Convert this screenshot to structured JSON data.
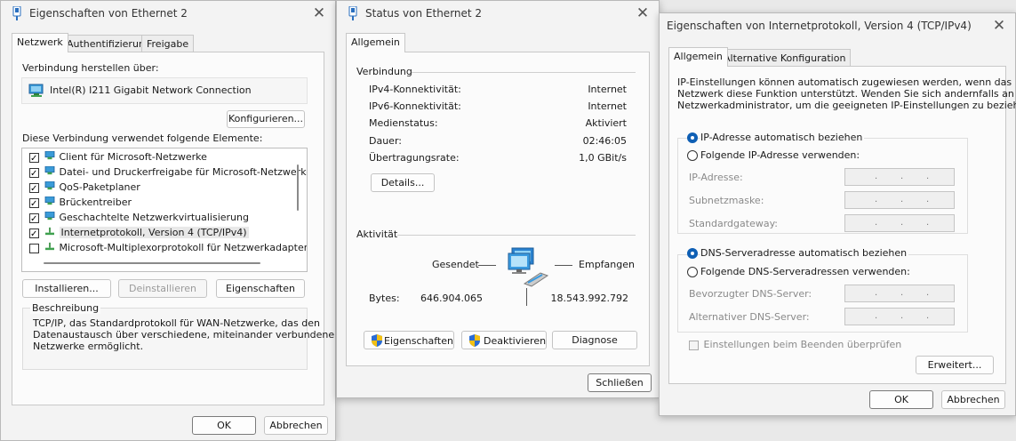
{
  "ethernet_props": {
    "title": "Eigenschaften von Ethernet 2",
    "tabs": [
      "Netzwerk",
      "Authentifizierung",
      "Freigabe"
    ],
    "connect_via_label": "Verbindung herstellen über:",
    "adapter_name": "Intel(R) I211 Gigabit Network Connection",
    "configure_button": "Konfigurieren...",
    "items_label": "Diese Verbindung verwendet folgende Elemente:",
    "items": [
      {
        "label": "Client für Microsoft-Netzwerke",
        "checked": true
      },
      {
        "label": "Datei- und Druckerfreigabe für Microsoft-Netzwerke",
        "checked": true
      },
      {
        "label": "QoS-Paketplaner",
        "checked": true
      },
      {
        "label": "Brückentreiber",
        "checked": true
      },
      {
        "label": "Geschachtelte Netzwerkvirtualisierung",
        "checked": true
      },
      {
        "label": "Internetprotokoll, Version 4 (TCP/IPv4)",
        "checked": true
      },
      {
        "label": "Microsoft-Multiplexorprotokoll für Netzwerkadapter",
        "checked": false
      }
    ],
    "install_button": "Installieren...",
    "uninstall_button": "Deinstallieren",
    "properties_button": "Eigenschaften",
    "description_label": "Beschreibung",
    "description_text_1": "TCP/IP, das Standardprotokoll für WAN-Netzwerke, das den",
    "description_text_2": "Datenaustausch über verschiedene, miteinander verbundene",
    "description_text_3": "Netzwerke ermöglicht.",
    "ok_button": "OK",
    "cancel_button": "Abbrechen"
  },
  "status": {
    "title": "Status von Ethernet 2",
    "tab": "Allgemein",
    "connection_label": "Verbindung",
    "rows": [
      {
        "label": "IPv4-Konnektivität:",
        "value": "Internet"
      },
      {
        "label": "IPv6-Konnektivität:",
        "value": "Internet"
      },
      {
        "label": "Medienstatus:",
        "value": "Aktiviert"
      },
      {
        "label": "Dauer:",
        "value": "02:46:05"
      },
      {
        "label": "Übertragungsrate:",
        "value": "1,0 GBit/s"
      }
    ],
    "details_button": "Details...",
    "activity_label": "Aktivität",
    "sent_label": "Gesendet",
    "received_label": "Empfangen",
    "bytes_label": "Bytes:",
    "bytes_sent": "646.904.065",
    "bytes_received": "18.543.992.792",
    "properties_button": "Eigenschaften",
    "disable_button": "Deaktivieren",
    "diagnose_button": "Diagnose",
    "close_button": "Schließen"
  },
  "ipv4": {
    "title": "Eigenschaften von Internetprotokoll, Version 4 (TCP/IPv4)",
    "tabs": [
      "Allgemein",
      "Alternative Konfiguration"
    ],
    "intro_1": "IP-Einstellungen können automatisch zugewiesen werden, wenn das",
    "intro_2": "Netzwerk diese Funktion unterstützt. Wenden Sie sich andernfalls an den",
    "intro_3": "Netzwerkadministrator, um die geeigneten IP-Einstellungen zu beziehen.",
    "ip_auto": "IP-Adresse automatisch beziehen",
    "ip_manual": "Folgende IP-Adresse verwenden:",
    "ip_address_label": "IP-Adresse:",
    "subnet_label": "Subnetzmaske:",
    "gateway_label": "Standardgateway:",
    "dns_auto": "DNS-Serveradresse automatisch beziehen",
    "dns_manual": "Folgende DNS-Serveradressen verwenden:",
    "dns_preferred_label": "Bevorzugter DNS-Server:",
    "dns_alternate_label": "Alternativer DNS-Server:",
    "validate_label": "Einstellungen beim Beenden überprüfen",
    "advanced_button": "Erweitert...",
    "ok_button": "OK",
    "cancel_button": "Abbrechen",
    "ip_selected": "auto",
    "dns_selected": "auto"
  },
  "colors": {
    "accent": "#0f5fb4",
    "shield_blue": "#2b6cd4",
    "shield_yellow": "#f2c014"
  },
  "icons": [
    "network-adapter-icon",
    "network-connection-icon",
    "shield-icon"
  ]
}
